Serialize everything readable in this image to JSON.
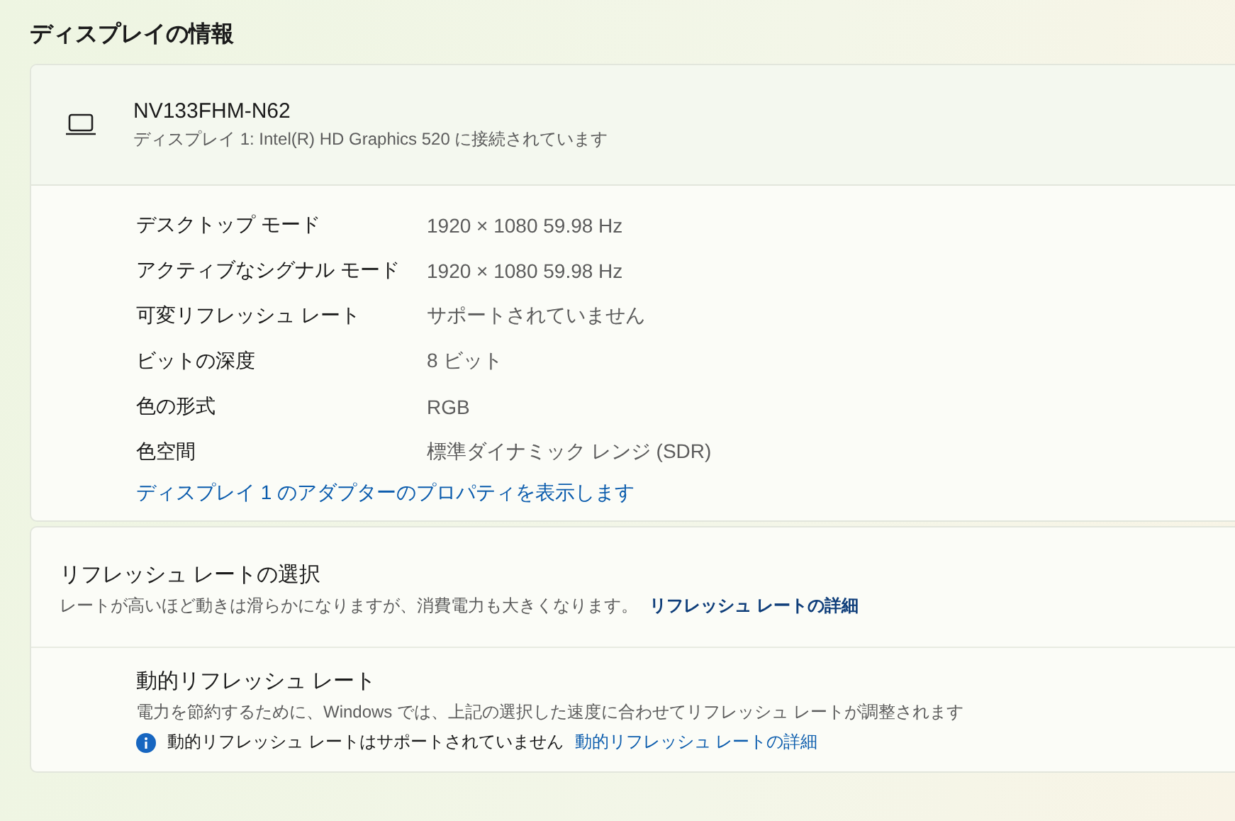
{
  "section_title": "ディスプレイの情報",
  "display": {
    "name": "NV133FHM-N62",
    "subtitle": "ディスプレイ 1: Intel(R) HD Graphics 520 に接続されています"
  },
  "properties": [
    {
      "label": "デスクトップ モード",
      "value": "1920 × 1080 59.98 Hz"
    },
    {
      "label": "アクティブなシグナル モード",
      "value": "1920 × 1080 59.98 Hz"
    },
    {
      "label": "可変リフレッシュ レート",
      "value": "サポートされていません"
    },
    {
      "label": "ビットの深度",
      "value": "8 ビット"
    },
    {
      "label": "色の形式",
      "value": "RGB"
    },
    {
      "label": "色空間",
      "value": "標準ダイナミック レンジ (SDR)"
    }
  ],
  "adapter_link": "ディスプレイ 1 のアダプターのプロパティを表示します",
  "refresh_rate": {
    "title": "リフレッシュ レートの選択",
    "description": "レートが高いほど動きは滑らかになりますが、消費電力も大きくなります。",
    "link": "リフレッシュ レートの詳細"
  },
  "dynamic_refresh": {
    "title": "動的リフレッシュ レート",
    "description": "電力を節約するために、Windows では、上記の選択した速度に合わせてリフレッシュ レートが調整されます",
    "info": "動的リフレッシュ レートはサポートされていません",
    "link": "動的リフレッシュ レートの詳細"
  }
}
